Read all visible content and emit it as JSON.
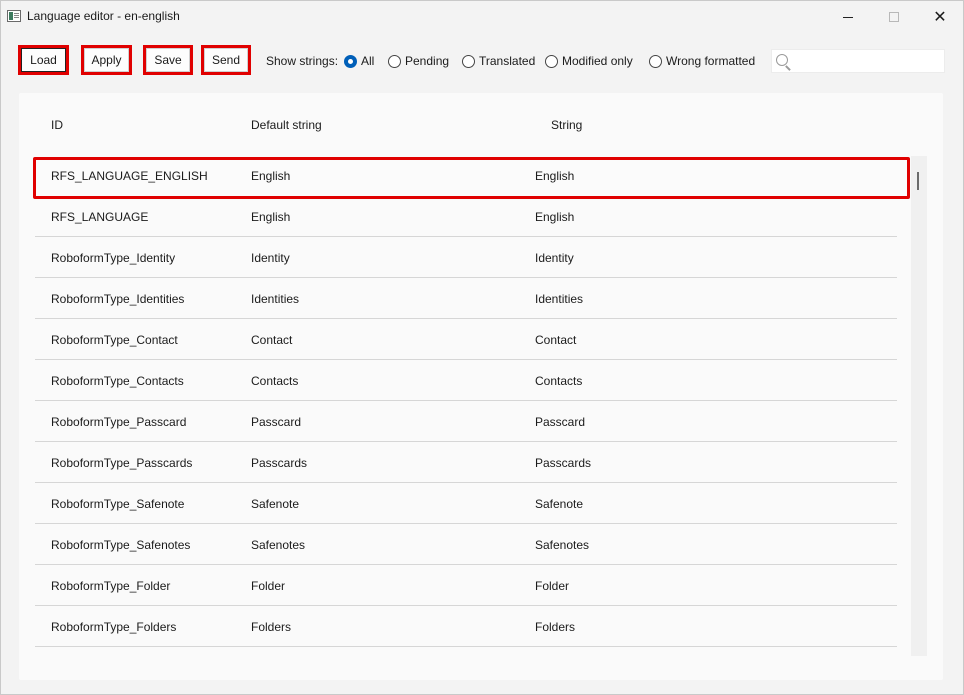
{
  "window": {
    "title": "Language editor - en-english",
    "minimize_icon": "minimize-icon",
    "maximize_icon": "maximize-icon",
    "close_icon": "close-icon",
    "close_glyph": "✕"
  },
  "toolbar": {
    "load_label": "Load",
    "apply_label": "Apply",
    "save_label": "Save",
    "send_label": "Send",
    "show_strings_label": "Show strings:",
    "filters": [
      {
        "label": "All",
        "checked": true
      },
      {
        "label": "Pending",
        "checked": false
      },
      {
        "label": "Translated",
        "checked": false
      },
      {
        "label": "Modified only",
        "checked": false
      },
      {
        "label": "Wrong formatted",
        "checked": false
      }
    ],
    "search_value": "",
    "search_icon": "search-icon"
  },
  "table": {
    "headers": {
      "id": "ID",
      "default": "Default string",
      "string": "String"
    },
    "rows": [
      {
        "id": "RFS_LANGUAGE_ENGLISH",
        "default": "English",
        "string": "English"
      },
      {
        "id": "RFS_LANGUAGE",
        "default": "English",
        "string": "English"
      },
      {
        "id": "RoboformType_Identity",
        "default": "Identity",
        "string": "Identity"
      },
      {
        "id": "RoboformType_Identities",
        "default": "Identities",
        "string": "Identities"
      },
      {
        "id": "RoboformType_Contact",
        "default": "Contact",
        "string": "Contact"
      },
      {
        "id": "RoboformType_Contacts",
        "default": "Contacts",
        "string": "Contacts"
      },
      {
        "id": "RoboformType_Passcard",
        "default": "Passcard",
        "string": "Passcard"
      },
      {
        "id": "RoboformType_Passcards",
        "default": "Passcards",
        "string": "Passcards"
      },
      {
        "id": "RoboformType_Safenote",
        "default": "Safenote",
        "string": "Safenote"
      },
      {
        "id": "RoboformType_Safenotes",
        "default": "Safenotes",
        "string": "Safenotes"
      },
      {
        "id": "RoboformType_Folder",
        "default": "Folder",
        "string": "Folder"
      },
      {
        "id": "RoboformType_Folders",
        "default": "Folders",
        "string": "Folders"
      }
    ]
  },
  "colors": {
    "highlight": "#e00000",
    "radio_checked": "#005fb8"
  }
}
